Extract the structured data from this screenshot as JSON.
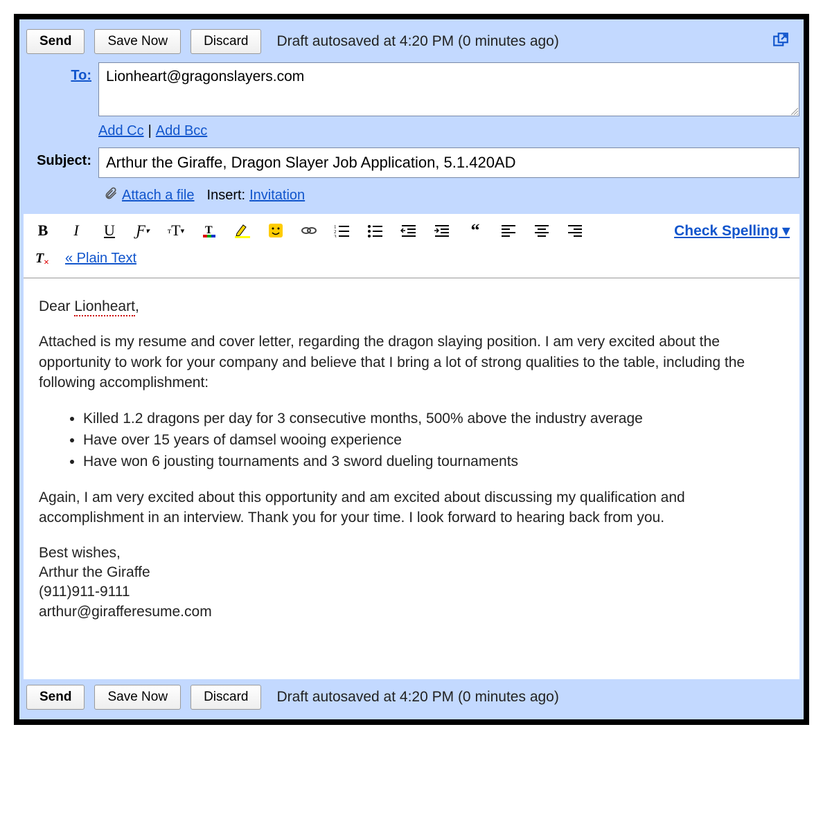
{
  "actions": {
    "send": "Send",
    "save_now": "Save Now",
    "discard": "Discard",
    "autosave": "Draft autosaved at 4:20 PM (0 minutes ago)"
  },
  "fields": {
    "to_label": "To:",
    "to_value": "Lionheart@gragonslayers.com",
    "add_cc": "Add Cc",
    "add_bcc": "Add Bcc",
    "subject_label": "Subject:",
    "subject_value": "Arthur the Giraffe, Dragon Slayer Job Application, 5.1.420AD",
    "attach": "Attach a file",
    "insert_label": "Insert:",
    "invitation": "Invitation"
  },
  "toolbar": {
    "check_spelling": "Check Spelling ▾",
    "plain_text": "« Plain Text"
  },
  "body": {
    "greeting_pre": "Dear ",
    "greeting_name": "Lionheart",
    "greeting_post": ",",
    "p1": "Attached is my resume and cover letter, regarding the dragon slaying position.  I am very excited about the opportunity to work for your company and believe that I bring a lot of strong qualities to the table, including the following accomplishment:",
    "bullets": [
      "Killed 1.2 dragons per day for 3 consecutive months, 500% above the industry average",
      "Have over 15 years of damsel wooing experience",
      "Have won 6 jousting tournaments and 3 sword dueling tournaments"
    ],
    "p2": "Again, I am very excited about this opportunity and am excited about discussing my qualification and accomplishment in an interview.  Thank you for your time.  I look forward to hearing back from you.",
    "sig1": "Best wishes,",
    "sig2": "Arthur the Giraffe",
    "sig3": "(911)911-9111",
    "sig4": "arthur@girafferesume.com"
  }
}
